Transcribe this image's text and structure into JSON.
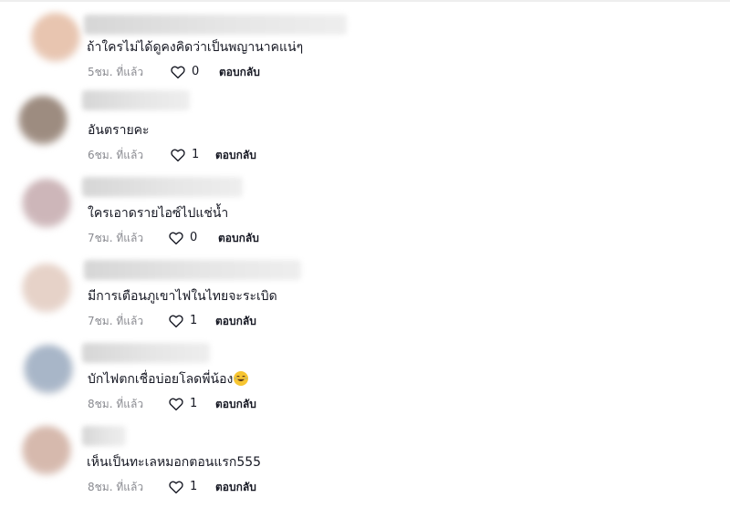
{
  "comments": [
    {
      "text": "ถ้าใครไม่ได้ดูคงคิดว่าเป็นพญานาคแน่ๆ",
      "time": "5ชม. ที่แล้ว",
      "likes": "0",
      "reply": "ตอบกลับ",
      "avatar_color": "#e8c5b0"
    },
    {
      "text": "อันตรายคะ",
      "time": "6ชม. ที่แล้ว",
      "likes": "1",
      "reply": "ตอบกลับ",
      "avatar_color": "#9d8c80"
    },
    {
      "text": "ใครเอาดรายไอซ์ไปแช่น้ำ",
      "time": "7ชม. ที่แล้ว",
      "likes": "0",
      "reply": "ตอบกลับ",
      "avatar_color": "#cdb6b9"
    },
    {
      "text": "มีการเตือนภูเขาไฟในไทยจะระเบิด",
      "time": "7ชม. ที่แล้ว",
      "likes": "1",
      "reply": "ตอบกลับ",
      "avatar_color": "#e6d2c8"
    },
    {
      "text": "บักไฟตกเชื่อบ่อยโลดพี่น้อง",
      "emoji": "tears-of-joy-emoji",
      "time": "8ชม. ที่แล้ว",
      "likes": "1",
      "reply": "ตอบกลับ",
      "avatar_color": "#a8b6c8"
    },
    {
      "text": "เห็นเป็นทะเลหมอกตอนแรก555",
      "time": "8ชม. ที่แล้ว",
      "likes": "1",
      "reply": "ตอบกลับ",
      "avatar_color": "#d6b9ad"
    }
  ]
}
